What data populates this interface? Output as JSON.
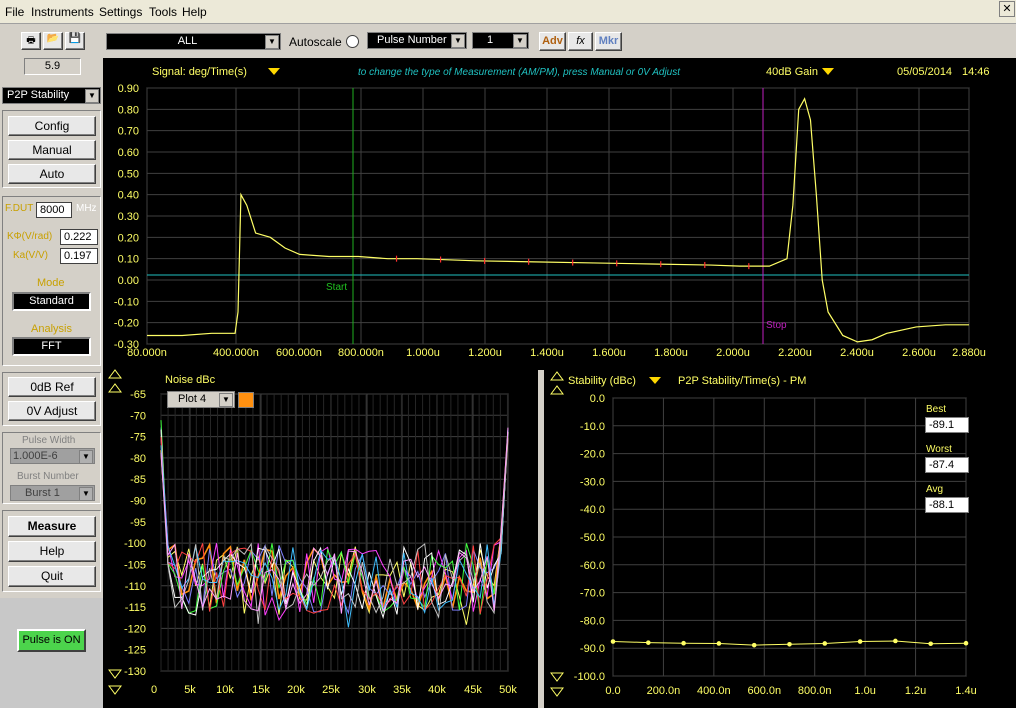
{
  "menu": [
    "File",
    "Instruments",
    "Settings",
    "Tools",
    "Help"
  ],
  "left": {
    "version": "5.9",
    "mode_select": "P2P Stability",
    "config": "Config",
    "manual": "Manual",
    "auto": "Auto",
    "fdut_label": "F.DUT",
    "fdut_value": "8000",
    "fdut_unit": "MHz",
    "kphi_label": "KΦ(V/rad)",
    "kphi_value": "0.222",
    "ka_label": "Ka(V/V)",
    "ka_value": "0.197",
    "mode_label": "Mode",
    "mode_value": "Standard",
    "analysis_label": "Analysis",
    "analysis_value": "FFT",
    "zero_db_ref": "0dB Ref",
    "zero_v_adjust": "0V Adjust",
    "pulse_width_label": "Pulse Width",
    "pulse_width_value": "1.000E-6",
    "burst_number_label": "Burst Number",
    "burst_value": "Burst 1",
    "measure": "Measure",
    "help": "Help",
    "quit": "Quit",
    "pulse_status": "Pulse is ON"
  },
  "toolbar": {
    "channel": "ALL",
    "autoscale": "Autoscale",
    "pulse_select": "Pulse Number",
    "pulse_index": "1",
    "adv": "Adv",
    "fx": "fx",
    "mkr": "Mkr"
  },
  "top_chart": {
    "signal": "Signal: deg/Time(s)",
    "hint": "to change the type of Measurement (AM/PM), press Manual or 0V Adjust",
    "gain": "40dB Gain",
    "date": "05/05/2014",
    "time": "14:46",
    "start_label": "Start",
    "stop_label": "Stop"
  },
  "noise_chart": {
    "title": "Noise dBc",
    "plot_select": "Plot 4"
  },
  "stab_chart": {
    "title": "Stability (dBc)",
    "subtitle": "P2P Stability/Time(s) - PM",
    "best_label": "Best",
    "best_value": "-89.1",
    "worst_label": "Worst",
    "worst_value": "-87.4",
    "avg_label": "Avg",
    "avg_value": "-88.1"
  },
  "chart_data": [
    {
      "type": "line",
      "name": "signal",
      "x_ticks": [
        "80.000n",
        "400.000n",
        "600.000n",
        "800.000n",
        "1.000u",
        "1.200u",
        "1.400u",
        "1.600u",
        "1.800u",
        "2.000u",
        "2.200u",
        "2.400u",
        "2.600u",
        "2.880u"
      ],
      "ylim": [
        -0.3,
        0.9
      ],
      "y_ticks": [
        "0.90",
        "0.80",
        "0.70",
        "0.60",
        "0.50",
        "0.40",
        "0.30",
        "0.20",
        "0.10",
        "0.00",
        "-0.10",
        "-0.20",
        "-0.30"
      ],
      "x_us": [
        0.08,
        0.2,
        0.3,
        0.38,
        0.39,
        0.4,
        0.42,
        0.45,
        0.5,
        0.55,
        0.6,
        0.7,
        0.8,
        0.9,
        1.0,
        1.2,
        1.4,
        1.6,
        1.8,
        2.0,
        2.1,
        2.2,
        2.26,
        2.28,
        2.3,
        2.32,
        2.34,
        2.36,
        2.38,
        2.4,
        2.45,
        2.5,
        2.55,
        2.6,
        2.7,
        2.8,
        2.88
      ],
      "y": [
        -0.26,
        -0.26,
        -0.25,
        -0.25,
        -0.15,
        0.4,
        0.35,
        0.22,
        0.2,
        0.15,
        0.12,
        0.11,
        0.11,
        0.1,
        0.1,
        0.09,
        0.085,
        0.08,
        0.075,
        0.07,
        0.065,
        0.065,
        0.1,
        0.35,
        0.8,
        0.85,
        0.75,
        0.4,
        0.0,
        -0.15,
        -0.26,
        -0.29,
        -0.28,
        -0.25,
        -0.22,
        -0.21,
        -0.21
      ]
    },
    {
      "type": "line",
      "name": "noise",
      "x_ticks": [
        "0",
        "5k",
        "10k",
        "15k",
        "20k",
        "25k",
        "30k",
        "35k",
        "40k",
        "45k",
        "50k"
      ],
      "y_ticks": [
        "-65",
        "-70",
        "-75",
        "-80",
        "-85",
        "-90",
        "-95",
        "-100",
        "-105",
        "-110",
        "-115",
        "-120",
        "-125",
        "-130"
      ],
      "ylim": [
        -130,
        -65
      ]
    },
    {
      "type": "line",
      "name": "stability",
      "x_ticks": [
        "0.0",
        "200.0n",
        "400.0n",
        "600.0n",
        "800.0n",
        "1.0u",
        "1.2u",
        "1.4u"
      ],
      "y_ticks": [
        "0.0",
        "-10.0",
        "-20.0",
        "-30.0",
        "-40.0",
        "-50.0",
        "-60.0",
        "-70.0",
        "-80.0",
        "-90.0",
        "-100.0"
      ],
      "ylim": [
        -100,
        0
      ],
      "x_ns": [
        0,
        140,
        280,
        420,
        560,
        700,
        840,
        980,
        1120,
        1260,
        1400
      ],
      "y": [
        -87.6,
        -88.0,
        -88.2,
        -88.3,
        -88.9,
        -88.6,
        -88.3,
        -87.6,
        -87.4,
        -88.4,
        -88.2
      ]
    }
  ]
}
